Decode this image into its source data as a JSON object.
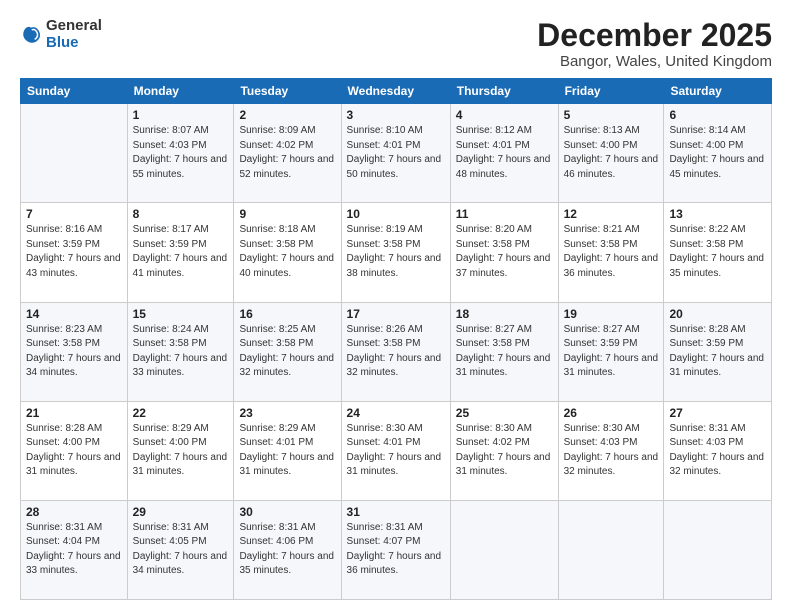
{
  "logo": {
    "general": "General",
    "blue": "Blue"
  },
  "header": {
    "month": "December 2025",
    "location": "Bangor, Wales, United Kingdom"
  },
  "weekdays": [
    "Sunday",
    "Monday",
    "Tuesday",
    "Wednesday",
    "Thursday",
    "Friday",
    "Saturday"
  ],
  "weeks": [
    [
      {
        "day": "",
        "sunrise": "",
        "sunset": "",
        "daylight": ""
      },
      {
        "day": "1",
        "sunrise": "Sunrise: 8:07 AM",
        "sunset": "Sunset: 4:03 PM",
        "daylight": "Daylight: 7 hours and 55 minutes."
      },
      {
        "day": "2",
        "sunrise": "Sunrise: 8:09 AM",
        "sunset": "Sunset: 4:02 PM",
        "daylight": "Daylight: 7 hours and 52 minutes."
      },
      {
        "day": "3",
        "sunrise": "Sunrise: 8:10 AM",
        "sunset": "Sunset: 4:01 PM",
        "daylight": "Daylight: 7 hours and 50 minutes."
      },
      {
        "day": "4",
        "sunrise": "Sunrise: 8:12 AM",
        "sunset": "Sunset: 4:01 PM",
        "daylight": "Daylight: 7 hours and 48 minutes."
      },
      {
        "day": "5",
        "sunrise": "Sunrise: 8:13 AM",
        "sunset": "Sunset: 4:00 PM",
        "daylight": "Daylight: 7 hours and 46 minutes."
      },
      {
        "day": "6",
        "sunrise": "Sunrise: 8:14 AM",
        "sunset": "Sunset: 4:00 PM",
        "daylight": "Daylight: 7 hours and 45 minutes."
      }
    ],
    [
      {
        "day": "7",
        "sunrise": "Sunrise: 8:16 AM",
        "sunset": "Sunset: 3:59 PM",
        "daylight": "Daylight: 7 hours and 43 minutes."
      },
      {
        "day": "8",
        "sunrise": "Sunrise: 8:17 AM",
        "sunset": "Sunset: 3:59 PM",
        "daylight": "Daylight: 7 hours and 41 minutes."
      },
      {
        "day": "9",
        "sunrise": "Sunrise: 8:18 AM",
        "sunset": "Sunset: 3:58 PM",
        "daylight": "Daylight: 7 hours and 40 minutes."
      },
      {
        "day": "10",
        "sunrise": "Sunrise: 8:19 AM",
        "sunset": "Sunset: 3:58 PM",
        "daylight": "Daylight: 7 hours and 38 minutes."
      },
      {
        "day": "11",
        "sunrise": "Sunrise: 8:20 AM",
        "sunset": "Sunset: 3:58 PM",
        "daylight": "Daylight: 7 hours and 37 minutes."
      },
      {
        "day": "12",
        "sunrise": "Sunrise: 8:21 AM",
        "sunset": "Sunset: 3:58 PM",
        "daylight": "Daylight: 7 hours and 36 minutes."
      },
      {
        "day": "13",
        "sunrise": "Sunrise: 8:22 AM",
        "sunset": "Sunset: 3:58 PM",
        "daylight": "Daylight: 7 hours and 35 minutes."
      }
    ],
    [
      {
        "day": "14",
        "sunrise": "Sunrise: 8:23 AM",
        "sunset": "Sunset: 3:58 PM",
        "daylight": "Daylight: 7 hours and 34 minutes."
      },
      {
        "day": "15",
        "sunrise": "Sunrise: 8:24 AM",
        "sunset": "Sunset: 3:58 PM",
        "daylight": "Daylight: 7 hours and 33 minutes."
      },
      {
        "day": "16",
        "sunrise": "Sunrise: 8:25 AM",
        "sunset": "Sunset: 3:58 PM",
        "daylight": "Daylight: 7 hours and 32 minutes."
      },
      {
        "day": "17",
        "sunrise": "Sunrise: 8:26 AM",
        "sunset": "Sunset: 3:58 PM",
        "daylight": "Daylight: 7 hours and 32 minutes."
      },
      {
        "day": "18",
        "sunrise": "Sunrise: 8:27 AM",
        "sunset": "Sunset: 3:58 PM",
        "daylight": "Daylight: 7 hours and 31 minutes."
      },
      {
        "day": "19",
        "sunrise": "Sunrise: 8:27 AM",
        "sunset": "Sunset: 3:59 PM",
        "daylight": "Daylight: 7 hours and 31 minutes."
      },
      {
        "day": "20",
        "sunrise": "Sunrise: 8:28 AM",
        "sunset": "Sunset: 3:59 PM",
        "daylight": "Daylight: 7 hours and 31 minutes."
      }
    ],
    [
      {
        "day": "21",
        "sunrise": "Sunrise: 8:28 AM",
        "sunset": "Sunset: 4:00 PM",
        "daylight": "Daylight: 7 hours and 31 minutes."
      },
      {
        "day": "22",
        "sunrise": "Sunrise: 8:29 AM",
        "sunset": "Sunset: 4:00 PM",
        "daylight": "Daylight: 7 hours and 31 minutes."
      },
      {
        "day": "23",
        "sunrise": "Sunrise: 8:29 AM",
        "sunset": "Sunset: 4:01 PM",
        "daylight": "Daylight: 7 hours and 31 minutes."
      },
      {
        "day": "24",
        "sunrise": "Sunrise: 8:30 AM",
        "sunset": "Sunset: 4:01 PM",
        "daylight": "Daylight: 7 hours and 31 minutes."
      },
      {
        "day": "25",
        "sunrise": "Sunrise: 8:30 AM",
        "sunset": "Sunset: 4:02 PM",
        "daylight": "Daylight: 7 hours and 31 minutes."
      },
      {
        "day": "26",
        "sunrise": "Sunrise: 8:30 AM",
        "sunset": "Sunset: 4:03 PM",
        "daylight": "Daylight: 7 hours and 32 minutes."
      },
      {
        "day": "27",
        "sunrise": "Sunrise: 8:31 AM",
        "sunset": "Sunset: 4:03 PM",
        "daylight": "Daylight: 7 hours and 32 minutes."
      }
    ],
    [
      {
        "day": "28",
        "sunrise": "Sunrise: 8:31 AM",
        "sunset": "Sunset: 4:04 PM",
        "daylight": "Daylight: 7 hours and 33 minutes."
      },
      {
        "day": "29",
        "sunrise": "Sunrise: 8:31 AM",
        "sunset": "Sunset: 4:05 PM",
        "daylight": "Daylight: 7 hours and 34 minutes."
      },
      {
        "day": "30",
        "sunrise": "Sunrise: 8:31 AM",
        "sunset": "Sunset: 4:06 PM",
        "daylight": "Daylight: 7 hours and 35 minutes."
      },
      {
        "day": "31",
        "sunrise": "Sunrise: 8:31 AM",
        "sunset": "Sunset: 4:07 PM",
        "daylight": "Daylight: 7 hours and 36 minutes."
      },
      {
        "day": "",
        "sunrise": "",
        "sunset": "",
        "daylight": ""
      },
      {
        "day": "",
        "sunrise": "",
        "sunset": "",
        "daylight": ""
      },
      {
        "day": "",
        "sunrise": "",
        "sunset": "",
        "daylight": ""
      }
    ]
  ]
}
